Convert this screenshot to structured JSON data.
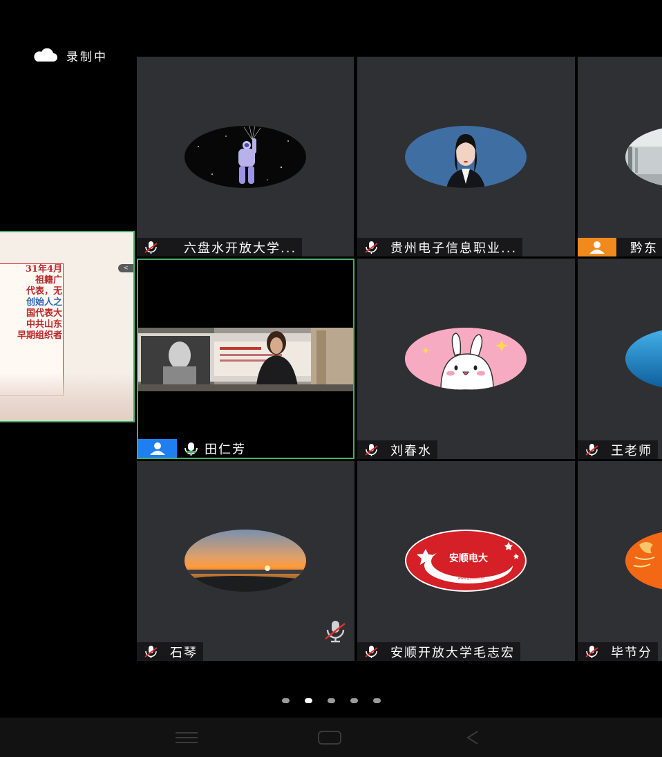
{
  "status": {
    "recording_label": "录制中"
  },
  "shared_screen": {
    "slide_lines": [
      "31年4月",
      "祖籍广",
      "代表，无",
      "创始人之",
      "国代表大",
      "中共山东",
      "早期组织者"
    ],
    "collapse_glyph": "<"
  },
  "participants": [
    {
      "name": "六盘水开放大学...",
      "mic": "muted",
      "role": "none",
      "avatar": "astronaut"
    },
    {
      "name": "贵州电子信息职业...",
      "mic": "muted",
      "role": "none",
      "avatar": "portrait"
    },
    {
      "name": "黔东",
      "mic": "none",
      "role": "orange-person",
      "avatar": "interior"
    },
    {
      "name": "田仁芳",
      "mic": "active",
      "role": "host",
      "avatar": "video"
    },
    {
      "name": "刘春水",
      "mic": "muted",
      "role": "none",
      "avatar": "bunny"
    },
    {
      "name": "王老师",
      "mic": "muted",
      "role": "none",
      "avatar": "sea"
    },
    {
      "name": "石琴",
      "mic": "muted",
      "role": "none",
      "avatar": "sunset"
    },
    {
      "name": "安顺开放大学毛志宏",
      "mic": "muted",
      "role": "none",
      "avatar": "logo"
    },
    {
      "name": "毕节分",
      "mic": "muted",
      "role": "none",
      "avatar": "orange-dragon"
    }
  ],
  "logo": {
    "text": "安顺电大",
    "subtext": "www.gzasdu.cn"
  },
  "pagination": {
    "total": 5,
    "active": 1
  },
  "colors": {
    "tile_bg": "#2f3033",
    "speaking_border": "#3fb36a",
    "host_badge": "#1f7ff0",
    "orange_badge": "#f08a1c",
    "muted_slash": "#e0302a"
  },
  "navigation": {
    "menu": "menu-icon",
    "home": "home-icon",
    "back": "back-icon"
  }
}
